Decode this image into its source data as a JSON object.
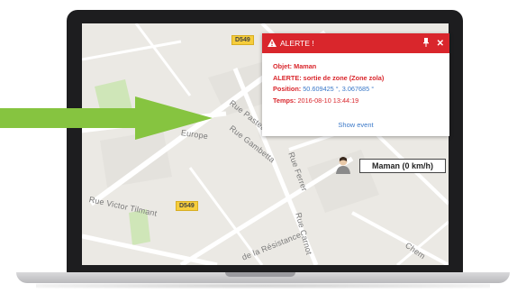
{
  "alert": {
    "title": "ALERTE !",
    "pin_icon": "pin-icon",
    "close_icon": "close-icon",
    "warning_icon": "warning-icon",
    "object_label": "Objet:",
    "object_value": "Maman",
    "alert_label": "ALERTE:",
    "alert_value": "sortie de zone (Zone zola)",
    "position_label": "Position:",
    "position_value": "50.609425 °, 3.067685 °",
    "time_label": "Temps:",
    "time_value": "2016-08-10 13:44:19",
    "show_event_label": "Show event"
  },
  "map": {
    "streets": [
      "Rue Pasteur",
      "Rue Gambetta",
      "Rue Ferrer",
      "Rue Carnot",
      "Rue Victor Tilmant",
      "de la Résistance",
      "Europe",
      "Chem"
    ],
    "road_shields": [
      "D549",
      "D549"
    ]
  },
  "vehicle": {
    "label": "Maman (0 km/h)",
    "icon": "person-marker-icon"
  },
  "colors": {
    "alert_red": "#d9262c",
    "link_blue": "#3a78c8",
    "arrow_green": "#86c440",
    "road_shield_yellow": "#f6cd3c"
  }
}
